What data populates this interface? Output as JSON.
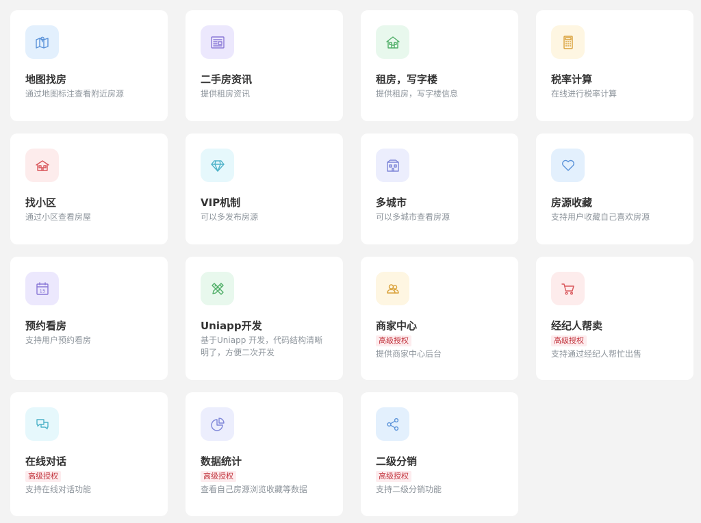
{
  "cards": [
    {
      "title": "地图找房",
      "desc": "通过地图标注查看附近房源",
      "icon": "map-icon",
      "color": "#5b93d9"
    },
    {
      "title": "二手房资讯",
      "desc": "提供租房资讯",
      "icon": "newspaper-icon",
      "color": "#8a78d6"
    },
    {
      "title": "租房，写字楼",
      "desc": "提供租房，写字楼信息",
      "icon": "house-icon",
      "color": "#4fae67"
    },
    {
      "title": "税率计算",
      "desc": "在线进行税率计算",
      "icon": "calculator-icon",
      "color": "#d9a13a"
    },
    {
      "title": "找小区",
      "desc": "通过小区查看房屋",
      "icon": "residence-icon",
      "color": "#d9565b"
    },
    {
      "title": "VIP机制",
      "desc": "可以多发布房源",
      "icon": "diamond-icon",
      "color": "#4fb3c9"
    },
    {
      "title": "多城市",
      "desc": "可以多城市查看房源",
      "icon": "city-icon",
      "color": "#7e86d8"
    },
    {
      "title": "房源收藏",
      "desc": "支持用户收藏自己喜欢房源",
      "icon": "heart-icon",
      "color": "#5b93d9"
    },
    {
      "title": "预约看房",
      "desc": "支持用户预约看房",
      "icon": "calendar-icon",
      "color": "#8a78d6",
      "calendar_day": "15"
    },
    {
      "title": "Uniapp开发",
      "desc": "基于Uniapp 开发，代码结构清晰明了，方便二次开发",
      "icon": "pencil-ruler-icon",
      "color": "#4fae67"
    },
    {
      "title": "商家中心",
      "badge": "高级授权",
      "desc": "提供商家中心后台",
      "icon": "users-icon",
      "color": "#d9a13a"
    },
    {
      "title": "经纪人帮卖",
      "badge": "高级授权",
      "desc": "支持通过经纪人帮忙出售",
      "icon": "cart-icon",
      "color": "#d9565b"
    },
    {
      "title": "在线对话",
      "badge": "高级授权",
      "desc": "支持在线对话功能",
      "icon": "chat-icon",
      "color": "#4fb3c9"
    },
    {
      "title": "数据统计",
      "badge": "高级授权",
      "desc": "查看自己房源浏览收藏等数据",
      "icon": "pie-chart-icon",
      "color": "#7e86d8"
    },
    {
      "title": "二级分销",
      "badge": "高级授权",
      "desc": "支持二级分销功能",
      "icon": "share-icon",
      "color": "#5b93d9"
    }
  ]
}
